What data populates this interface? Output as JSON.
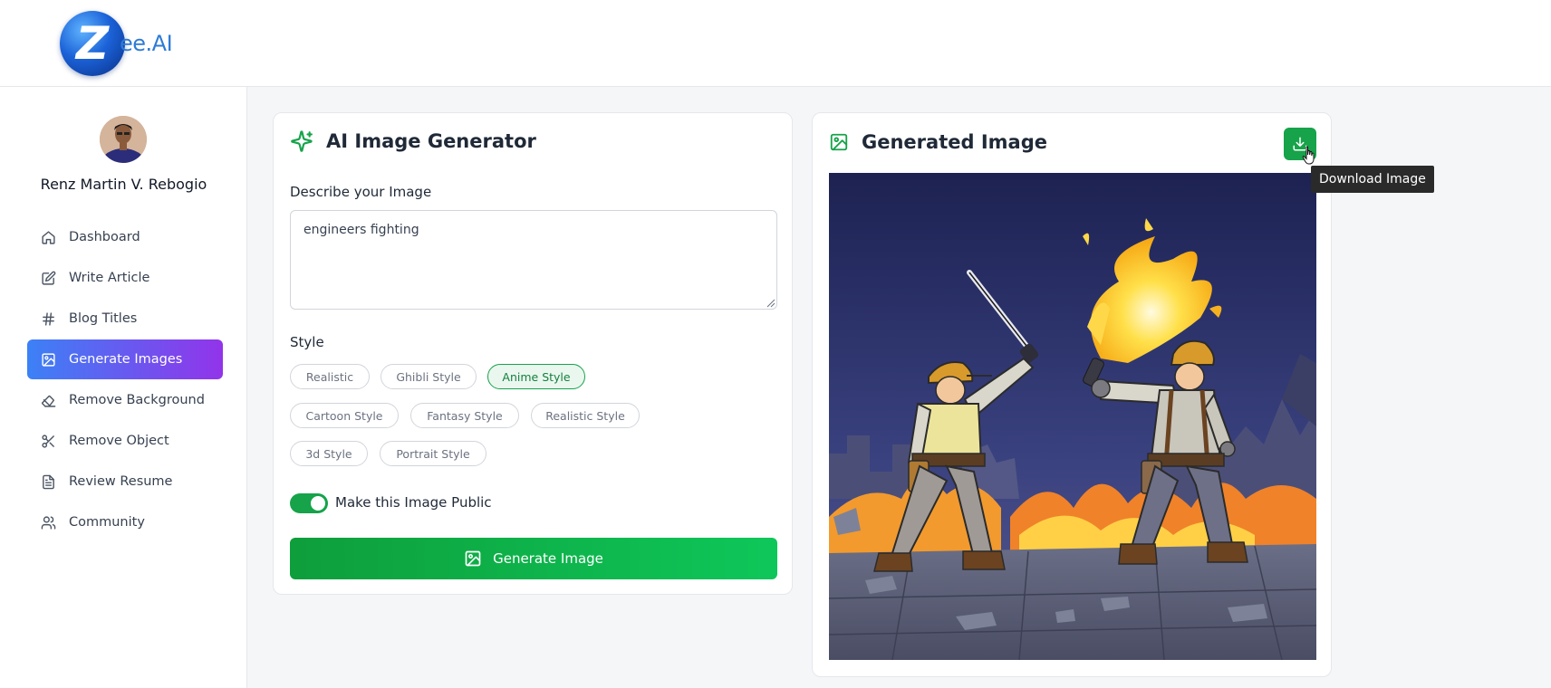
{
  "app": {
    "logo_letter": "Z",
    "logo_text": "ee.AI"
  },
  "user": {
    "name": "Renz Martin V. Rebogio"
  },
  "sidebar": {
    "items": [
      {
        "label": "Dashboard",
        "icon": "home-icon",
        "active": false
      },
      {
        "label": "Write Article",
        "icon": "edit-icon",
        "active": false
      },
      {
        "label": "Blog Titles",
        "icon": "hash-icon",
        "active": false
      },
      {
        "label": "Generate Images",
        "icon": "image-icon",
        "active": true
      },
      {
        "label": "Remove Background",
        "icon": "eraser-icon",
        "active": false
      },
      {
        "label": "Remove Object",
        "icon": "scissors-icon",
        "active": false
      },
      {
        "label": "Review Resume",
        "icon": "file-text-icon",
        "active": false
      },
      {
        "label": "Community",
        "icon": "users-icon",
        "active": false
      }
    ],
    "active_gradient": [
      "#3c81f6",
      "#9234ea"
    ]
  },
  "generator": {
    "title": "AI Image Generator",
    "describe_label": "Describe your Image",
    "prompt_value": "engineers fighting",
    "style_label": "Style",
    "styles": [
      {
        "label": "Realistic",
        "selected": false
      },
      {
        "label": "Ghibli Style",
        "selected": false
      },
      {
        "label": "Anime Style",
        "selected": true
      },
      {
        "label": "Cartoon Style",
        "selected": false
      },
      {
        "label": "Fantasy Style",
        "selected": false
      },
      {
        "label": "Realistic Style",
        "selected": false
      },
      {
        "label": "3d Style",
        "selected": false
      },
      {
        "label": "Portrait Style",
        "selected": false
      }
    ],
    "public_toggle_label": "Make this Image Public",
    "public_toggle_on": true,
    "generate_button_label": "Generate Image",
    "accent_color": "#16a34a"
  },
  "output": {
    "title": "Generated Image",
    "download_tooltip": "Download Image"
  }
}
